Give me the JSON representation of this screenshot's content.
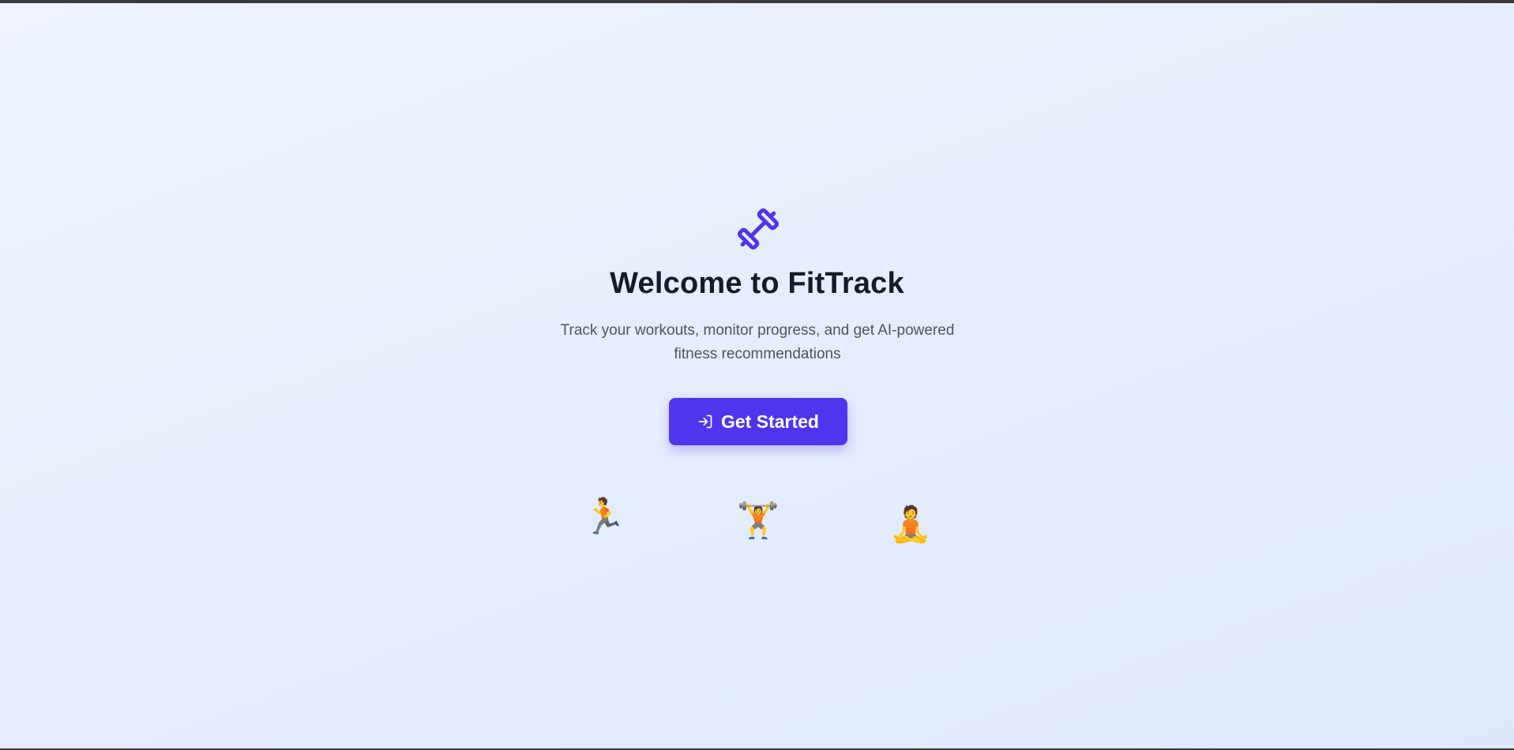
{
  "hero": {
    "logo_icon": "dumbbell-icon",
    "title": "Welcome to FitTrack",
    "subtitle": "Track your workouts, monitor progress, and get AI-powered fitness recommendations",
    "cta_label": "Get Started",
    "cta_icon": "log-in-icon"
  },
  "activities": [
    {
      "icon": "person-running-icon",
      "glyph": "🏃"
    },
    {
      "icon": "person-lifting-weights-icon",
      "glyph": "🏋"
    },
    {
      "icon": "person-lotus-position-icon",
      "glyph": "🧘"
    }
  ],
  "colors": {
    "accent": "#4f35ee",
    "title": "#141b2d",
    "subtitle": "#4b5563",
    "background_start": "#eef3ff",
    "background_end": "#dde9fb"
  }
}
